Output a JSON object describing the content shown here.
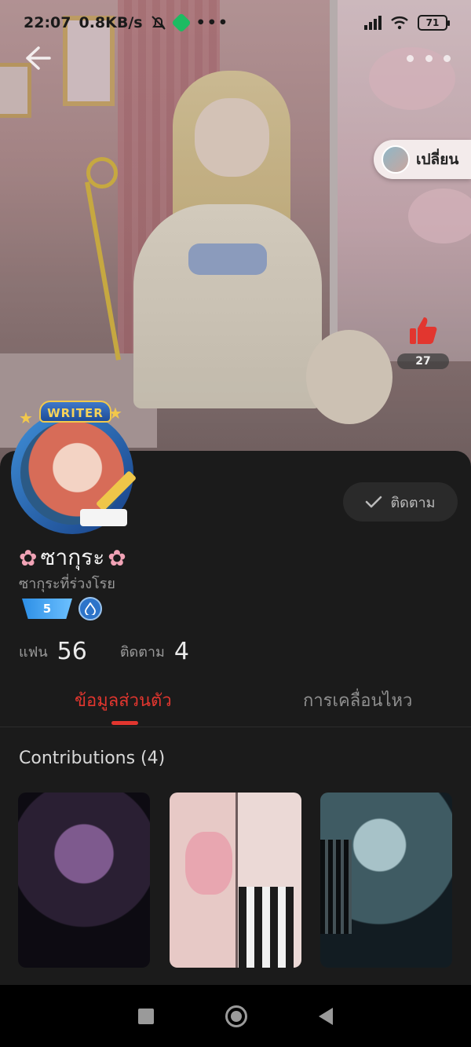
{
  "status_bar": {
    "time": "22:07",
    "speed": "0.8KB/s",
    "more": "•••",
    "battery": "71"
  },
  "hero": {
    "switch_label": "เปลี่ยน",
    "like_count": "27"
  },
  "profile": {
    "badge_text": "WRITER",
    "follow_label": "ติดตาม",
    "name": "ซากุระ",
    "name_decor": "✿",
    "subtitle": "ซากุระที่ร่วงโรย",
    "level": "5",
    "stats": [
      {
        "label": "แฟน",
        "value": "56"
      },
      {
        "label": "ติดตาม",
        "value": "4"
      }
    ]
  },
  "tabs": [
    {
      "label": "ข้อมูลส่วนตัว",
      "active": true
    },
    {
      "label": "การเคลื่อนไหว",
      "active": false
    }
  ],
  "contributions": {
    "title": "Contributions (4)"
  },
  "colors": {
    "accent": "#e2362f",
    "background": "#1b1b1b"
  }
}
